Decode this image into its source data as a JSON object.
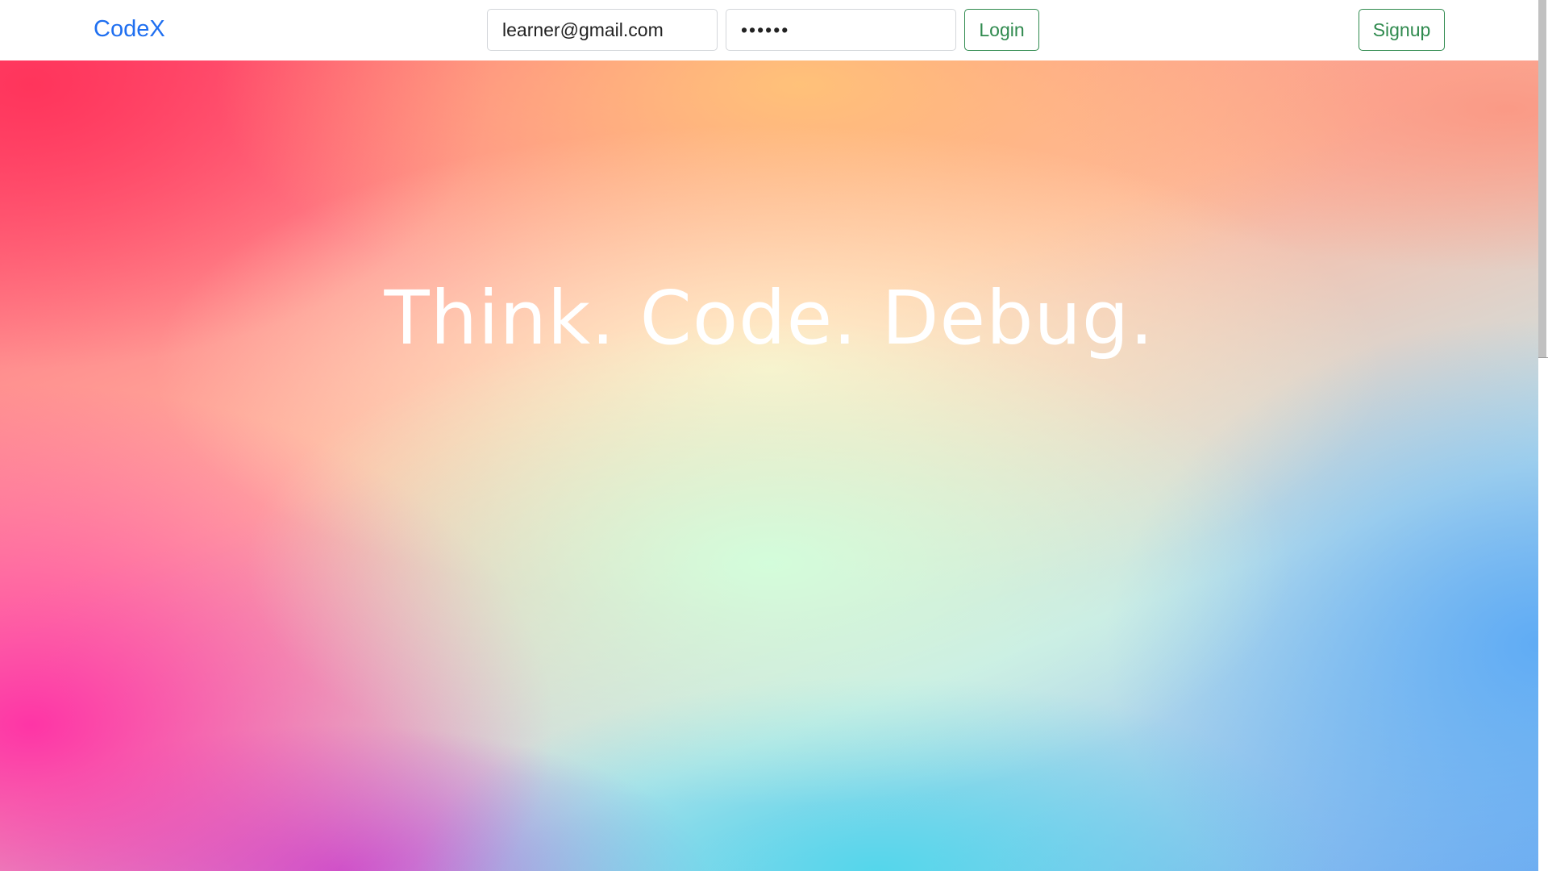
{
  "navbar": {
    "brand": "CodeX",
    "email_value": "learner@gmail.com",
    "password_value": "••••••",
    "login_label": "Login",
    "signup_label": "Signup"
  },
  "hero": {
    "headline": "Think. Code. Debug."
  },
  "colors": {
    "brand": "#1f6ff0",
    "button_outline": "#2f8a4e",
    "headline": "#ffffff"
  }
}
